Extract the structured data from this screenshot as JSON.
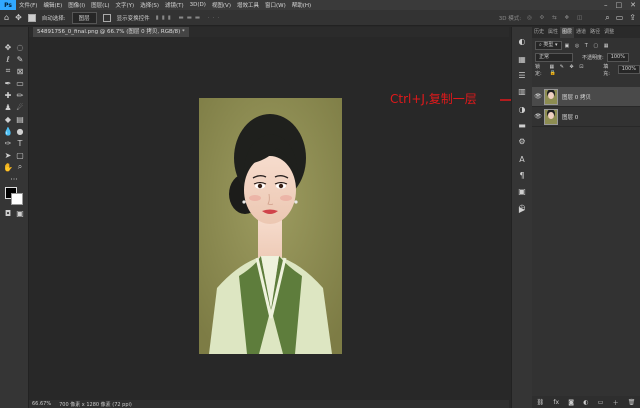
{
  "menubar": {
    "logo": "Ps",
    "items": [
      "文件(F)",
      "编辑(E)",
      "图像(I)",
      "图层(L)",
      "文字(Y)",
      "选择(S)",
      "滤镜(T)",
      "3D(D)",
      "视图(V)",
      "增效工具",
      "窗口(W)",
      "帮助(H)"
    ]
  },
  "optionsbar": {
    "auto_select": "自动选择:",
    "layer_dropdown": "图层",
    "show_transform": "显示变换控件",
    "mode_3d": "3D 模式:"
  },
  "document": {
    "tab_title": "54891756_0_final.png @ 66.7% (图层 0 拷贝, RGB/8) *"
  },
  "status": {
    "zoom": "66.67%",
    "size": "700 像素 x 1280 像素 (72 ppi)"
  },
  "panel": {
    "tabs": [
      "历史",
      "属性",
      "图层",
      "通道",
      "路径",
      "调整"
    ],
    "active_tab": "图层",
    "kind_label": "类型",
    "blend_mode": "正常",
    "opacity_label": "不透明度:",
    "opacity_value": "100%",
    "lock_label": "锁定:",
    "fill_label": "填充:",
    "fill_value": "100%",
    "layers": [
      {
        "name": "图层 0 拷贝",
        "selected": true
      },
      {
        "name": "图层 0",
        "selected": false
      }
    ]
  },
  "annotation": {
    "text": "Ctrl+J,复制一层",
    "color": "#e0191b"
  }
}
